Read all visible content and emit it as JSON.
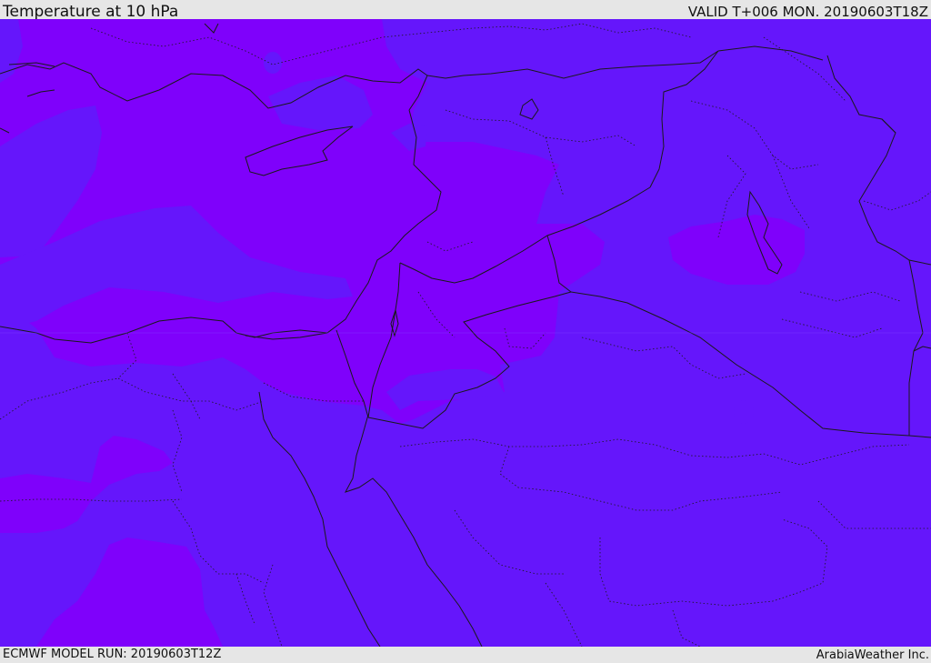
{
  "header": {
    "title": "Temperature at 10 hPa",
    "valid_time": "VALID T+006 MON. 20190603T18Z"
  },
  "footer": {
    "model_run": "ECMWF MODEL RUN: 20190603T12Z",
    "credit": "ArabiaWeather Inc."
  },
  "colors": {
    "field_blue_violet": "#6516fb",
    "field_violet": "#7f01fb",
    "coastline": "#1a1a1a",
    "border": "#1a1a1a"
  }
}
